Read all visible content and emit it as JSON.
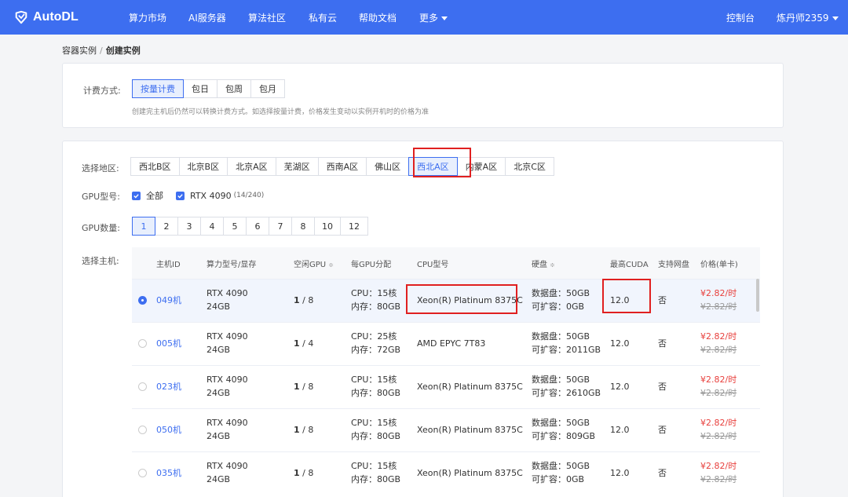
{
  "nav": {
    "brand": "AutoDL",
    "items": [
      "算力市场",
      "AI服务器",
      "算法社区",
      "私有云",
      "帮助文档",
      "更多"
    ],
    "console": "控制台",
    "user": "炼丹师2359"
  },
  "breadcrumb": {
    "parent": "容器实例",
    "sep": "/",
    "current": "创建实例"
  },
  "billing": {
    "label": "计费方式:",
    "options": [
      "按量计费",
      "包日",
      "包周",
      "包月"
    ],
    "hint": "创建完主机后仍然可以转换计费方式。如选择按量计费，价格发生变动以实例开机时的价格为准"
  },
  "region": {
    "label": "选择地区:",
    "options": [
      "西北B区",
      "北京B区",
      "北京A区",
      "芜湖区",
      "西南A区",
      "佛山区",
      "西北A区",
      "内蒙A区",
      "北京C区"
    ]
  },
  "gpu_model": {
    "label": "GPU型号:",
    "all": "全部",
    "model": "RTX 4090",
    "count": "(14/240)"
  },
  "gpu_count": {
    "label": "GPU数量:",
    "options": [
      "1",
      "2",
      "3",
      "4",
      "5",
      "6",
      "7",
      "8",
      "10",
      "12"
    ]
  },
  "host": {
    "label": "选择主机:",
    "headers": [
      "主机ID",
      "算力型号/显存",
      "空闲GPU",
      "每GPU分配",
      "CPU型号",
      "硬盘",
      "最高CUDA",
      "支持网盘",
      "价格(单卡)"
    ],
    "sort_icon": "≑",
    "rows": [
      {
        "id": "049机",
        "gpu": "RTX 4090",
        "mem": "24GB",
        "free": "1",
        "total": "/ 8",
        "cpu": "CPU：15核",
        "ram": "内存：80GB",
        "cpu_model": "Xeon(R) Platinum 8375C",
        "disk": "数据盘：50GB",
        "expand": "可扩容：0GB",
        "cuda": "12.0",
        "netdisk": "否",
        "price": "¥2.82/时",
        "old_price": "¥2.82/时"
      },
      {
        "id": "005机",
        "gpu": "RTX 4090",
        "mem": "24GB",
        "free": "1",
        "total": "/ 4",
        "cpu": "CPU：25核",
        "ram": "内存：72GB",
        "cpu_model": "AMD EPYC 7T83",
        "disk": "数据盘：50GB",
        "expand": "可扩容：2011GB",
        "cuda": "12.0",
        "netdisk": "否",
        "price": "¥2.82/时",
        "old_price": "¥2.82/时"
      },
      {
        "id": "023机",
        "gpu": "RTX 4090",
        "mem": "24GB",
        "free": "1",
        "total": "/ 8",
        "cpu": "CPU：15核",
        "ram": "内存：80GB",
        "cpu_model": "Xeon(R) Platinum 8375C",
        "disk": "数据盘：50GB",
        "expand": "可扩容：2610GB",
        "cuda": "12.0",
        "netdisk": "否",
        "price": "¥2.82/时",
        "old_price": "¥2.82/时"
      },
      {
        "id": "050机",
        "gpu": "RTX 4090",
        "mem": "24GB",
        "free": "1",
        "total": "/ 8",
        "cpu": "CPU：15核",
        "ram": "内存：80GB",
        "cpu_model": "Xeon(R) Platinum 8375C",
        "disk": "数据盘：50GB",
        "expand": "可扩容：809GB",
        "cuda": "12.0",
        "netdisk": "否",
        "price": "¥2.82/时",
        "old_price": "¥2.82/时"
      },
      {
        "id": "035机",
        "gpu": "RTX 4090",
        "mem": "24GB",
        "free": "1",
        "total": "/ 8",
        "cpu": "CPU：15核",
        "ram": "内存：80GB",
        "cpu_model": "Xeon(R) Platinum 8375C",
        "disk": "数据盘：50GB",
        "expand": "可扩容：0GB",
        "cuda": "12.0",
        "netdisk": "否",
        "price": "¥2.82/时",
        "old_price": "¥2.82/时"
      }
    ]
  },
  "colors": {
    "primary": "#3d6ef0",
    "highlight": "#e02020",
    "price": "#e8413e"
  }
}
